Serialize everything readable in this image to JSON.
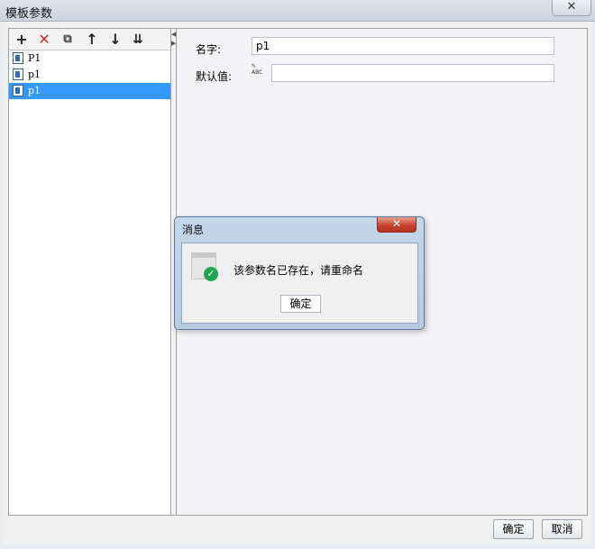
{
  "window": {
    "title": "模板参数",
    "close_glyph": "✕"
  },
  "toolbar": {
    "add_icon": "plus-icon",
    "delete_icon": "delete-icon",
    "copy_icon": "copy-icon",
    "up_icon": "move-up-icon",
    "down_icon": "move-down-icon",
    "bottom_icon": "move-bottom-icon"
  },
  "tree": {
    "items": [
      {
        "label": "P1",
        "selected": false
      },
      {
        "label": "p1",
        "selected": false
      },
      {
        "label": "p1",
        "selected": true
      }
    ]
  },
  "form": {
    "name_label": "名字:",
    "name_value": "p1",
    "default_label": "默认值:",
    "default_value": "",
    "type_icon_text": "ABC"
  },
  "buttons": {
    "ok": "确定",
    "cancel": "取消"
  },
  "dialog": {
    "title": "消息",
    "message": "该参数名已存在，请重命名",
    "ok": "确定",
    "close_glyph": "✕"
  },
  "colors": {
    "selection": "#3399ff",
    "delete_red": "#e0262a",
    "success_green": "#23a651"
  }
}
